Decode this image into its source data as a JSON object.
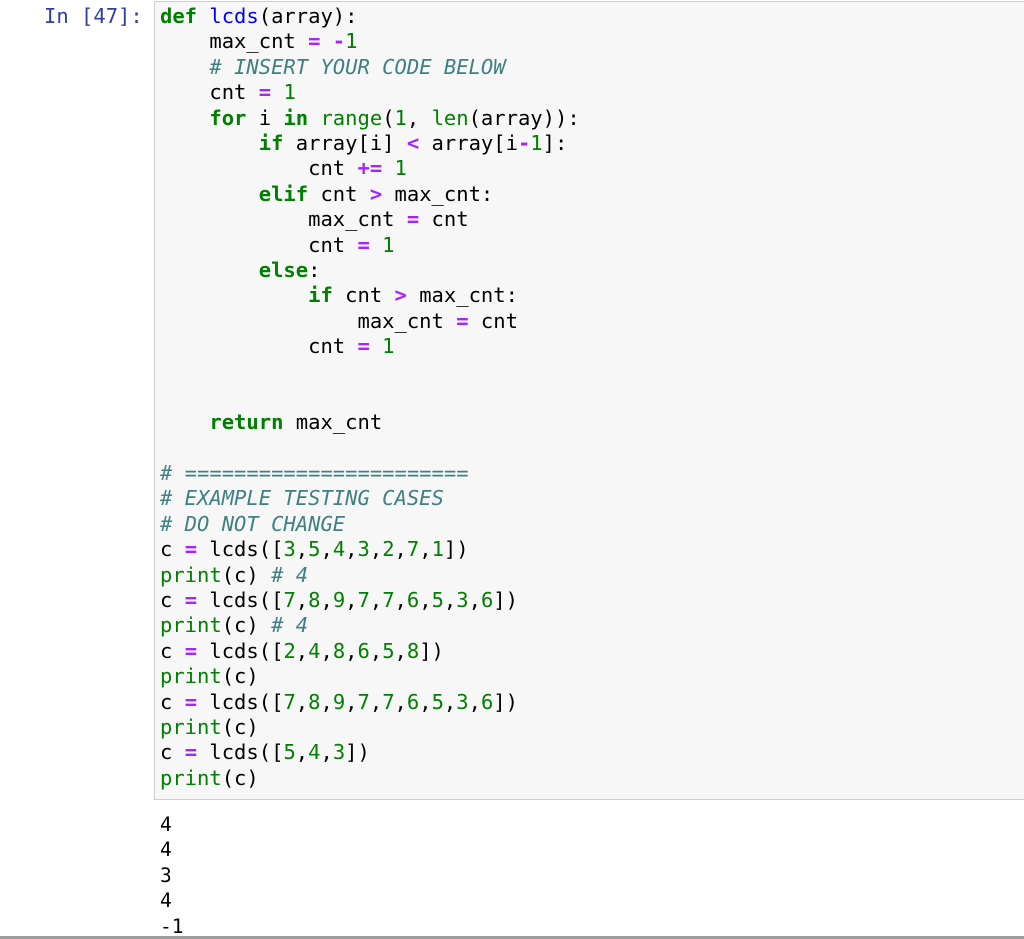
{
  "cell": {
    "prompt": "In [47]:",
    "lines": [
      [
        {
          "t": "kw",
          "v": "def"
        },
        {
          "t": "",
          "v": " "
        },
        {
          "t": "fn",
          "v": "lcds"
        },
        {
          "t": "",
          "v": "(array):"
        }
      ],
      [
        {
          "t": "",
          "v": "    max_cnt "
        },
        {
          "t": "op",
          "v": "="
        },
        {
          "t": "",
          "v": " "
        },
        {
          "t": "op",
          "v": "-"
        },
        {
          "t": "num",
          "v": "1"
        }
      ],
      [
        {
          "t": "",
          "v": "    "
        },
        {
          "t": "com",
          "v": "# INSERT YOUR CODE BELOW"
        }
      ],
      [
        {
          "t": "",
          "v": "    cnt "
        },
        {
          "t": "op",
          "v": "="
        },
        {
          "t": "",
          "v": " "
        },
        {
          "t": "num",
          "v": "1"
        }
      ],
      [
        {
          "t": "",
          "v": "    "
        },
        {
          "t": "kw",
          "v": "for"
        },
        {
          "t": "",
          "v": " i "
        },
        {
          "t": "kw",
          "v": "in"
        },
        {
          "t": "",
          "v": " "
        },
        {
          "t": "bi",
          "v": "range"
        },
        {
          "t": "",
          "v": "("
        },
        {
          "t": "num",
          "v": "1"
        },
        {
          "t": "",
          "v": ", "
        },
        {
          "t": "bi",
          "v": "len"
        },
        {
          "t": "",
          "v": "(array)):"
        }
      ],
      [
        {
          "t": "",
          "v": "        "
        },
        {
          "t": "kw",
          "v": "if"
        },
        {
          "t": "",
          "v": " array[i] "
        },
        {
          "t": "op",
          "v": "<"
        },
        {
          "t": "",
          "v": " array[i"
        },
        {
          "t": "op",
          "v": "-"
        },
        {
          "t": "num",
          "v": "1"
        },
        {
          "t": "",
          "v": "]:"
        }
      ],
      [
        {
          "t": "",
          "v": "            cnt "
        },
        {
          "t": "op",
          "v": "+="
        },
        {
          "t": "",
          "v": " "
        },
        {
          "t": "num",
          "v": "1"
        }
      ],
      [
        {
          "t": "",
          "v": "        "
        },
        {
          "t": "kw",
          "v": "elif"
        },
        {
          "t": "",
          "v": " cnt "
        },
        {
          "t": "op",
          "v": ">"
        },
        {
          "t": "",
          "v": " max_cnt:"
        }
      ],
      [
        {
          "t": "",
          "v": "            max_cnt "
        },
        {
          "t": "op",
          "v": "="
        },
        {
          "t": "",
          "v": " cnt"
        }
      ],
      [
        {
          "t": "",
          "v": "            cnt "
        },
        {
          "t": "op",
          "v": "="
        },
        {
          "t": "",
          "v": " "
        },
        {
          "t": "num",
          "v": "1"
        }
      ],
      [
        {
          "t": "",
          "v": "        "
        },
        {
          "t": "kw",
          "v": "else"
        },
        {
          "t": "",
          "v": ":"
        }
      ],
      [
        {
          "t": "",
          "v": "            "
        },
        {
          "t": "kw",
          "v": "if"
        },
        {
          "t": "",
          "v": " cnt "
        },
        {
          "t": "op",
          "v": ">"
        },
        {
          "t": "",
          "v": " max_cnt:"
        }
      ],
      [
        {
          "t": "",
          "v": "                max_cnt "
        },
        {
          "t": "op",
          "v": "="
        },
        {
          "t": "",
          "v": " cnt"
        }
      ],
      [
        {
          "t": "",
          "v": "            cnt "
        },
        {
          "t": "op",
          "v": "="
        },
        {
          "t": "",
          "v": " "
        },
        {
          "t": "num",
          "v": "1"
        }
      ],
      [],
      [],
      [
        {
          "t": "",
          "v": "    "
        },
        {
          "t": "kw",
          "v": "return"
        },
        {
          "t": "",
          "v": " max_cnt"
        }
      ],
      [],
      [
        {
          "t": "com",
          "v": "# ======================="
        }
      ],
      [
        {
          "t": "com",
          "v": "# EXAMPLE TESTING CASES"
        }
      ],
      [
        {
          "t": "com",
          "v": "# DO NOT CHANGE"
        }
      ],
      [
        {
          "t": "",
          "v": "c "
        },
        {
          "t": "op",
          "v": "="
        },
        {
          "t": "",
          "v": " lcds(["
        },
        {
          "t": "num",
          "v": "3"
        },
        {
          "t": "",
          "v": ","
        },
        {
          "t": "num",
          "v": "5"
        },
        {
          "t": "",
          "v": ","
        },
        {
          "t": "num",
          "v": "4"
        },
        {
          "t": "",
          "v": ","
        },
        {
          "t": "num",
          "v": "3"
        },
        {
          "t": "",
          "v": ","
        },
        {
          "t": "num",
          "v": "2"
        },
        {
          "t": "",
          "v": ","
        },
        {
          "t": "num",
          "v": "7"
        },
        {
          "t": "",
          "v": ","
        },
        {
          "t": "num",
          "v": "1"
        },
        {
          "t": "",
          "v": "])"
        }
      ],
      [
        {
          "t": "bi",
          "v": "print"
        },
        {
          "t": "",
          "v": "(c) "
        },
        {
          "t": "com",
          "v": "# 4"
        }
      ],
      [
        {
          "t": "",
          "v": "c "
        },
        {
          "t": "op",
          "v": "="
        },
        {
          "t": "",
          "v": " lcds(["
        },
        {
          "t": "num",
          "v": "7"
        },
        {
          "t": "",
          "v": ","
        },
        {
          "t": "num",
          "v": "8"
        },
        {
          "t": "",
          "v": ","
        },
        {
          "t": "num",
          "v": "9"
        },
        {
          "t": "",
          "v": ","
        },
        {
          "t": "num",
          "v": "7"
        },
        {
          "t": "",
          "v": ","
        },
        {
          "t": "num",
          "v": "7"
        },
        {
          "t": "",
          "v": ","
        },
        {
          "t": "num",
          "v": "6"
        },
        {
          "t": "",
          "v": ","
        },
        {
          "t": "num",
          "v": "5"
        },
        {
          "t": "",
          "v": ","
        },
        {
          "t": "num",
          "v": "3"
        },
        {
          "t": "",
          "v": ","
        },
        {
          "t": "num",
          "v": "6"
        },
        {
          "t": "",
          "v": "])"
        }
      ],
      [
        {
          "t": "bi",
          "v": "print"
        },
        {
          "t": "",
          "v": "(c) "
        },
        {
          "t": "com",
          "v": "# 4"
        }
      ],
      [
        {
          "t": "",
          "v": "c "
        },
        {
          "t": "op",
          "v": "="
        },
        {
          "t": "",
          "v": " lcds(["
        },
        {
          "t": "num",
          "v": "2"
        },
        {
          "t": "",
          "v": ","
        },
        {
          "t": "num",
          "v": "4"
        },
        {
          "t": "",
          "v": ","
        },
        {
          "t": "num",
          "v": "8"
        },
        {
          "t": "",
          "v": ","
        },
        {
          "t": "num",
          "v": "6"
        },
        {
          "t": "",
          "v": ","
        },
        {
          "t": "num",
          "v": "5"
        },
        {
          "t": "",
          "v": ","
        },
        {
          "t": "num",
          "v": "8"
        },
        {
          "t": "",
          "v": "])"
        }
      ],
      [
        {
          "t": "bi",
          "v": "print"
        },
        {
          "t": "",
          "v": "(c)"
        }
      ],
      [
        {
          "t": "",
          "v": "c "
        },
        {
          "t": "op",
          "v": "="
        },
        {
          "t": "",
          "v": " lcds(["
        },
        {
          "t": "num",
          "v": "7"
        },
        {
          "t": "",
          "v": ","
        },
        {
          "t": "num",
          "v": "8"
        },
        {
          "t": "",
          "v": ","
        },
        {
          "t": "num",
          "v": "9"
        },
        {
          "t": "",
          "v": ","
        },
        {
          "t": "num",
          "v": "7"
        },
        {
          "t": "",
          "v": ","
        },
        {
          "t": "num",
          "v": "7"
        },
        {
          "t": "",
          "v": ","
        },
        {
          "t": "num",
          "v": "6"
        },
        {
          "t": "",
          "v": ","
        },
        {
          "t": "num",
          "v": "5"
        },
        {
          "t": "",
          "v": ","
        },
        {
          "t": "num",
          "v": "3"
        },
        {
          "t": "",
          "v": ","
        },
        {
          "t": "num",
          "v": "6"
        },
        {
          "t": "",
          "v": "])"
        }
      ],
      [
        {
          "t": "bi",
          "v": "print"
        },
        {
          "t": "",
          "v": "(c)"
        }
      ],
      [
        {
          "t": "",
          "v": "c "
        },
        {
          "t": "op",
          "v": "="
        },
        {
          "t": "",
          "v": " lcds(["
        },
        {
          "t": "num",
          "v": "5"
        },
        {
          "t": "",
          "v": ","
        },
        {
          "t": "num",
          "v": "4"
        },
        {
          "t": "",
          "v": ","
        },
        {
          "t": "num",
          "v": "3"
        },
        {
          "t": "",
          "v": "])"
        }
      ],
      [
        {
          "t": "bi",
          "v": "print"
        },
        {
          "t": "",
          "v": "(c)"
        }
      ]
    ],
    "output": [
      "4",
      "4",
      "3",
      "4",
      "-1"
    ]
  },
  "colors": {
    "prompt": "#303f9f",
    "keyword": "#008000",
    "function_name": "#0000ff",
    "operator": "#aa22ff",
    "comment": "#408080",
    "number": "#008000",
    "input_background": "#f7f7f7",
    "input_border": "#cfcfcf"
  }
}
